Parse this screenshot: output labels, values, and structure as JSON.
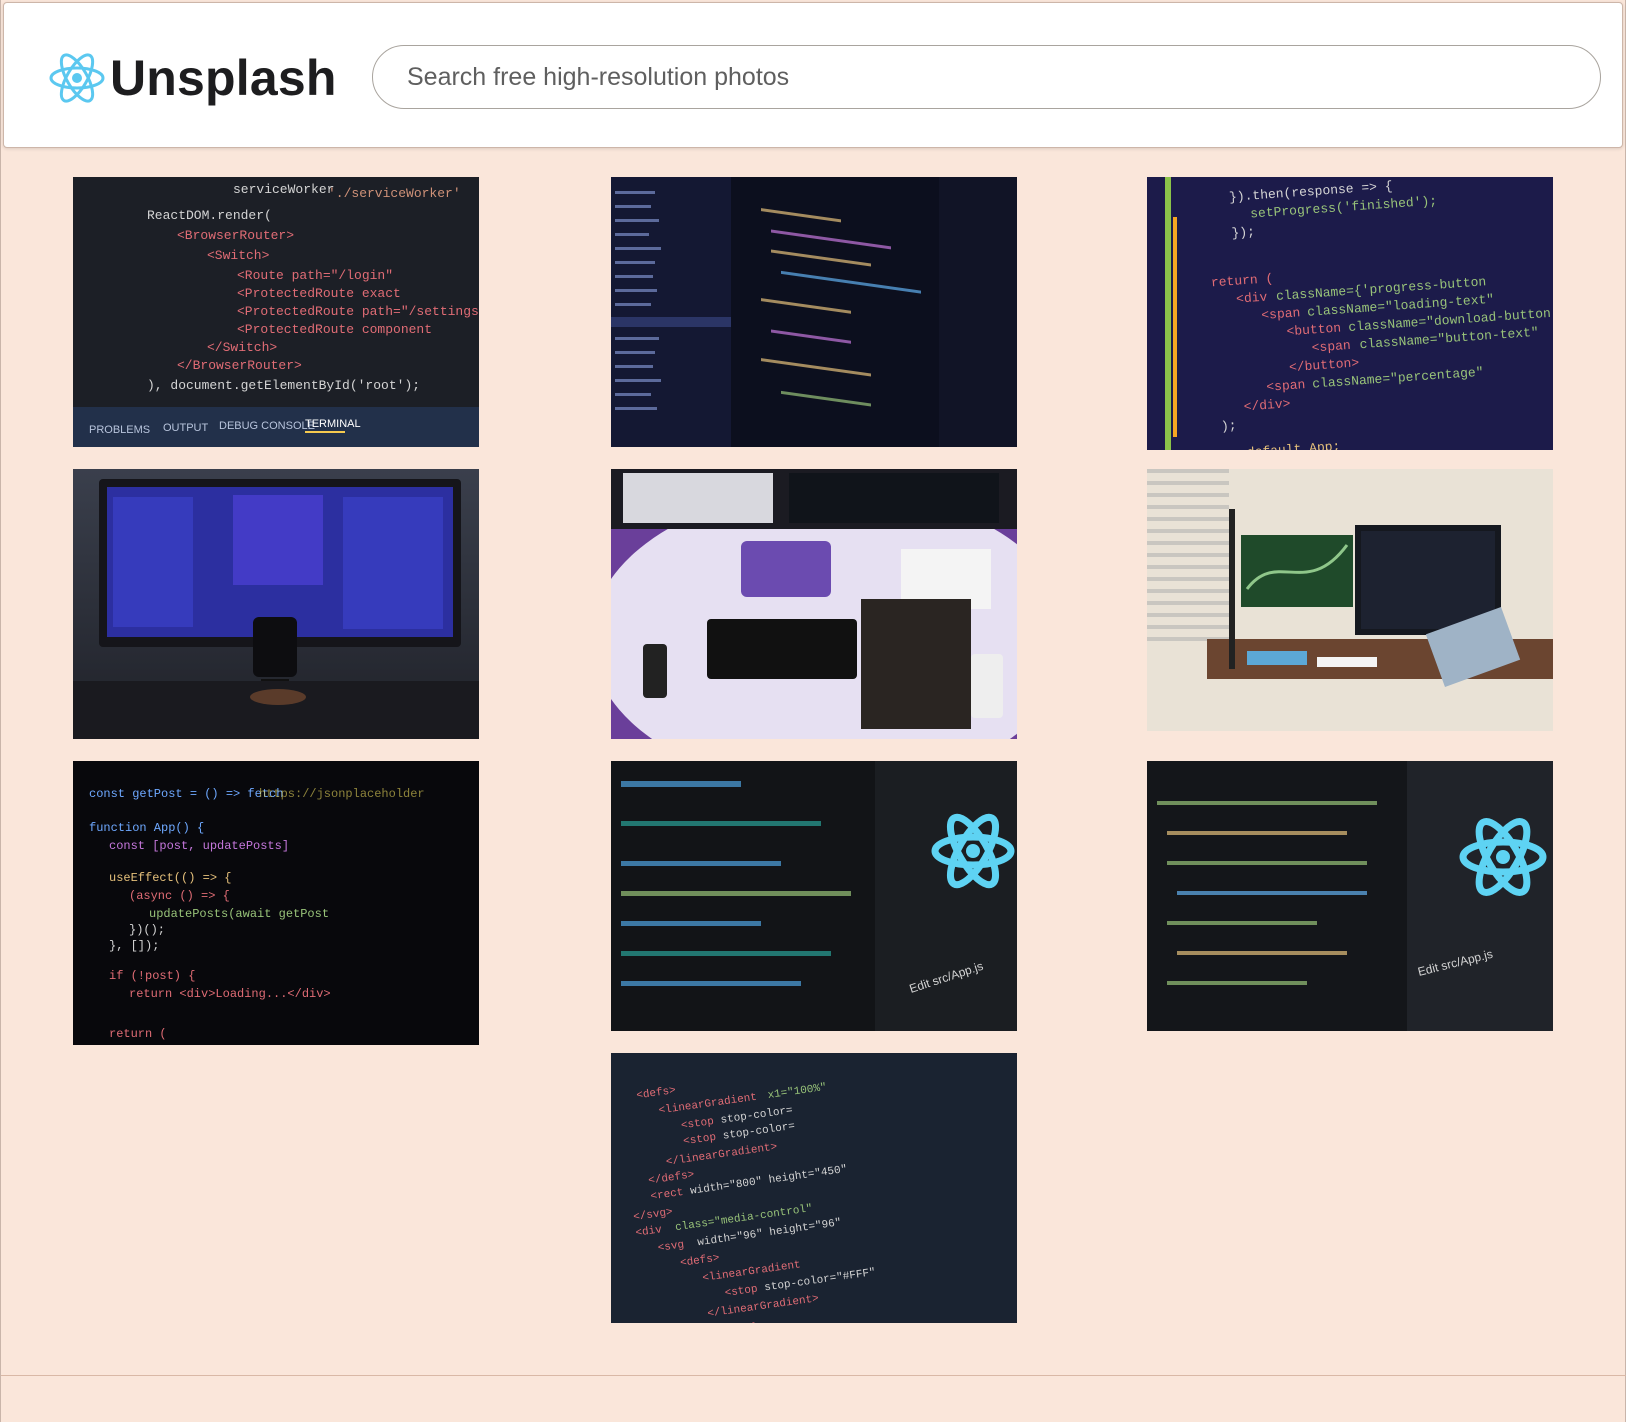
{
  "header": {
    "brand_name": "Unsplash",
    "search": {
      "placeholder": "Search free high-resolution photos",
      "value": ""
    }
  },
  "colors": {
    "page_background": "#fae6da",
    "header_background": "#ffffff",
    "logo_accent": "#5bc8f0"
  },
  "gallery": {
    "columns": [
      {
        "photos": [
          {
            "icon": "code-editor-react-router"
          },
          {
            "icon": "monitor-mug-desk"
          },
          {
            "icon": "code-fetch-blurred"
          }
        ]
      },
      {
        "photos": [
          {
            "icon": "code-monitor-angled"
          },
          {
            "icon": "desk-top-view-purple"
          },
          {
            "icon": "code-react-logo-screen"
          },
          {
            "icon": "code-svg-markup"
          }
        ]
      },
      {
        "photos": [
          {
            "icon": "code-progress-button"
          },
          {
            "icon": "desk-dual-monitor-laptop"
          },
          {
            "icon": "code-react-logo-screen-2"
          }
        ]
      }
    ]
  }
}
